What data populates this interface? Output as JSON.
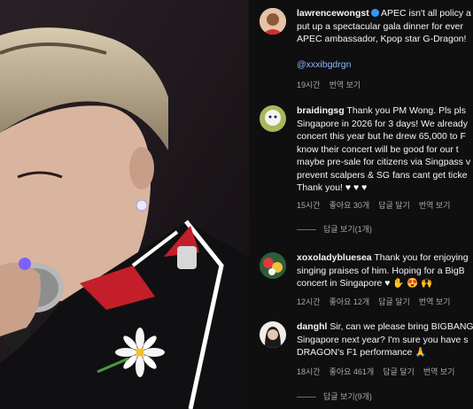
{
  "post": {
    "username": "lawrencewongst",
    "caption_lines": [
      "APEC isn't all policy a",
      "put up a spectacular gala dinner for ever",
      "APEC ambassador, Kpop star G-Dragon!"
    ],
    "mention": "@xxxibgdrgn",
    "time": "19시간",
    "translate": "번역 보기"
  },
  "comments": [
    {
      "username": "braidingsg",
      "lines": [
        "Thank you PM Wong. Pls pls",
        "Singapore in 2026 for 3 days! We already",
        "concert this year but he drew 65,000 to F",
        "know their concert will be good for our t",
        "maybe pre-sale for citizens via Singpass v",
        "prevent scalpers & SG fans cant get ticke",
        "Thank you! ♥ ♥ ♥"
      ],
      "time": "15시간",
      "likes": "좋아요 30개",
      "reply": "답글 달기",
      "translate": "번역 보기",
      "view_replies": "답글 보기(1개)"
    },
    {
      "username": "xoxoladybluesea",
      "lines": [
        "Thank you for enjoying",
        "singing praises of him. Hoping for a BigB",
        "concert in Singapore ♥ ✋ 😍 🙌"
      ],
      "time": "12시간",
      "likes": "좋아요 12개",
      "reply": "답글 달기",
      "translate": "번역 보기"
    },
    {
      "username": "danghl",
      "lines": [
        "Sir, can we please bring BIGBANG",
        "Singapore next year? I'm sure you have s",
        "DRAGON's F1 performance 🙏"
      ],
      "time": "18시간",
      "likes": "좋아요 461개",
      "reply": "답글 달기",
      "translate": "번역 보기",
      "view_replies": "답글 보기(9개)"
    }
  ],
  "colors": {
    "panel_bg": "#0f0f10",
    "muted": "#a8a8a8",
    "mention": "#8fb5ff",
    "heart": "#e0245e",
    "verified": "#3897f0"
  }
}
